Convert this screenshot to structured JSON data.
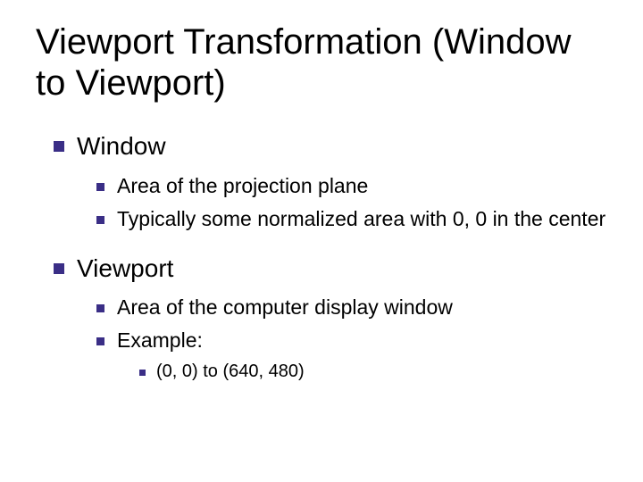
{
  "title": "Viewport Transformation (Window to Viewport)",
  "items": [
    {
      "label": "Window",
      "children": [
        {
          "label": "Area of the projection plane"
        },
        {
          "label": "Typically some normalized area with 0, 0 in the center"
        }
      ]
    },
    {
      "label": "Viewport",
      "children": [
        {
          "label": "Area of the computer display window"
        },
        {
          "label": "Example:",
          "children": [
            {
              "label": "(0, 0) to (640, 480)"
            }
          ]
        }
      ]
    }
  ]
}
